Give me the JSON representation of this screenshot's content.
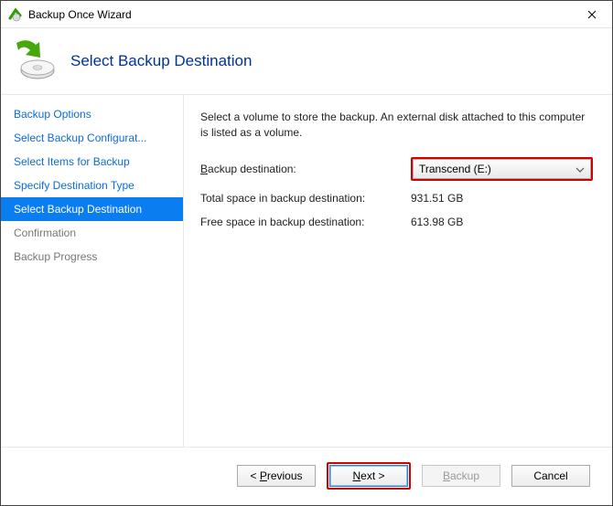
{
  "titlebar": {
    "title": "Backup Once Wizard"
  },
  "header": {
    "title": "Select Backup Destination"
  },
  "sidebar": {
    "items": [
      {
        "label": "Backup Options"
      },
      {
        "label": "Select Backup Configurat..."
      },
      {
        "label": "Select Items for Backup"
      },
      {
        "label": "Specify Destination Type"
      },
      {
        "label": "Select Backup Destination"
      },
      {
        "label": "Confirmation"
      },
      {
        "label": "Backup Progress"
      }
    ],
    "selected_index": 4
  },
  "content": {
    "description": "Select a volume to store the backup. An external disk attached to this computer is listed as a volume.",
    "destination_label_accesskey": "B",
    "destination_label_rest": "ackup destination:",
    "destination_value": "Transcend (E:)",
    "total_space_label": "Total space in backup destination:",
    "total_space_value": "931.51 GB",
    "free_space_label": "Free space in backup destination:",
    "free_space_value": "613.98 GB"
  },
  "footer": {
    "previous_accesskey": "P",
    "previous_rest": "revious",
    "next_accesskey": "N",
    "next_rest": "ext",
    "backup_accesskey": "B",
    "backup_rest": "ackup",
    "cancel": "Cancel"
  }
}
